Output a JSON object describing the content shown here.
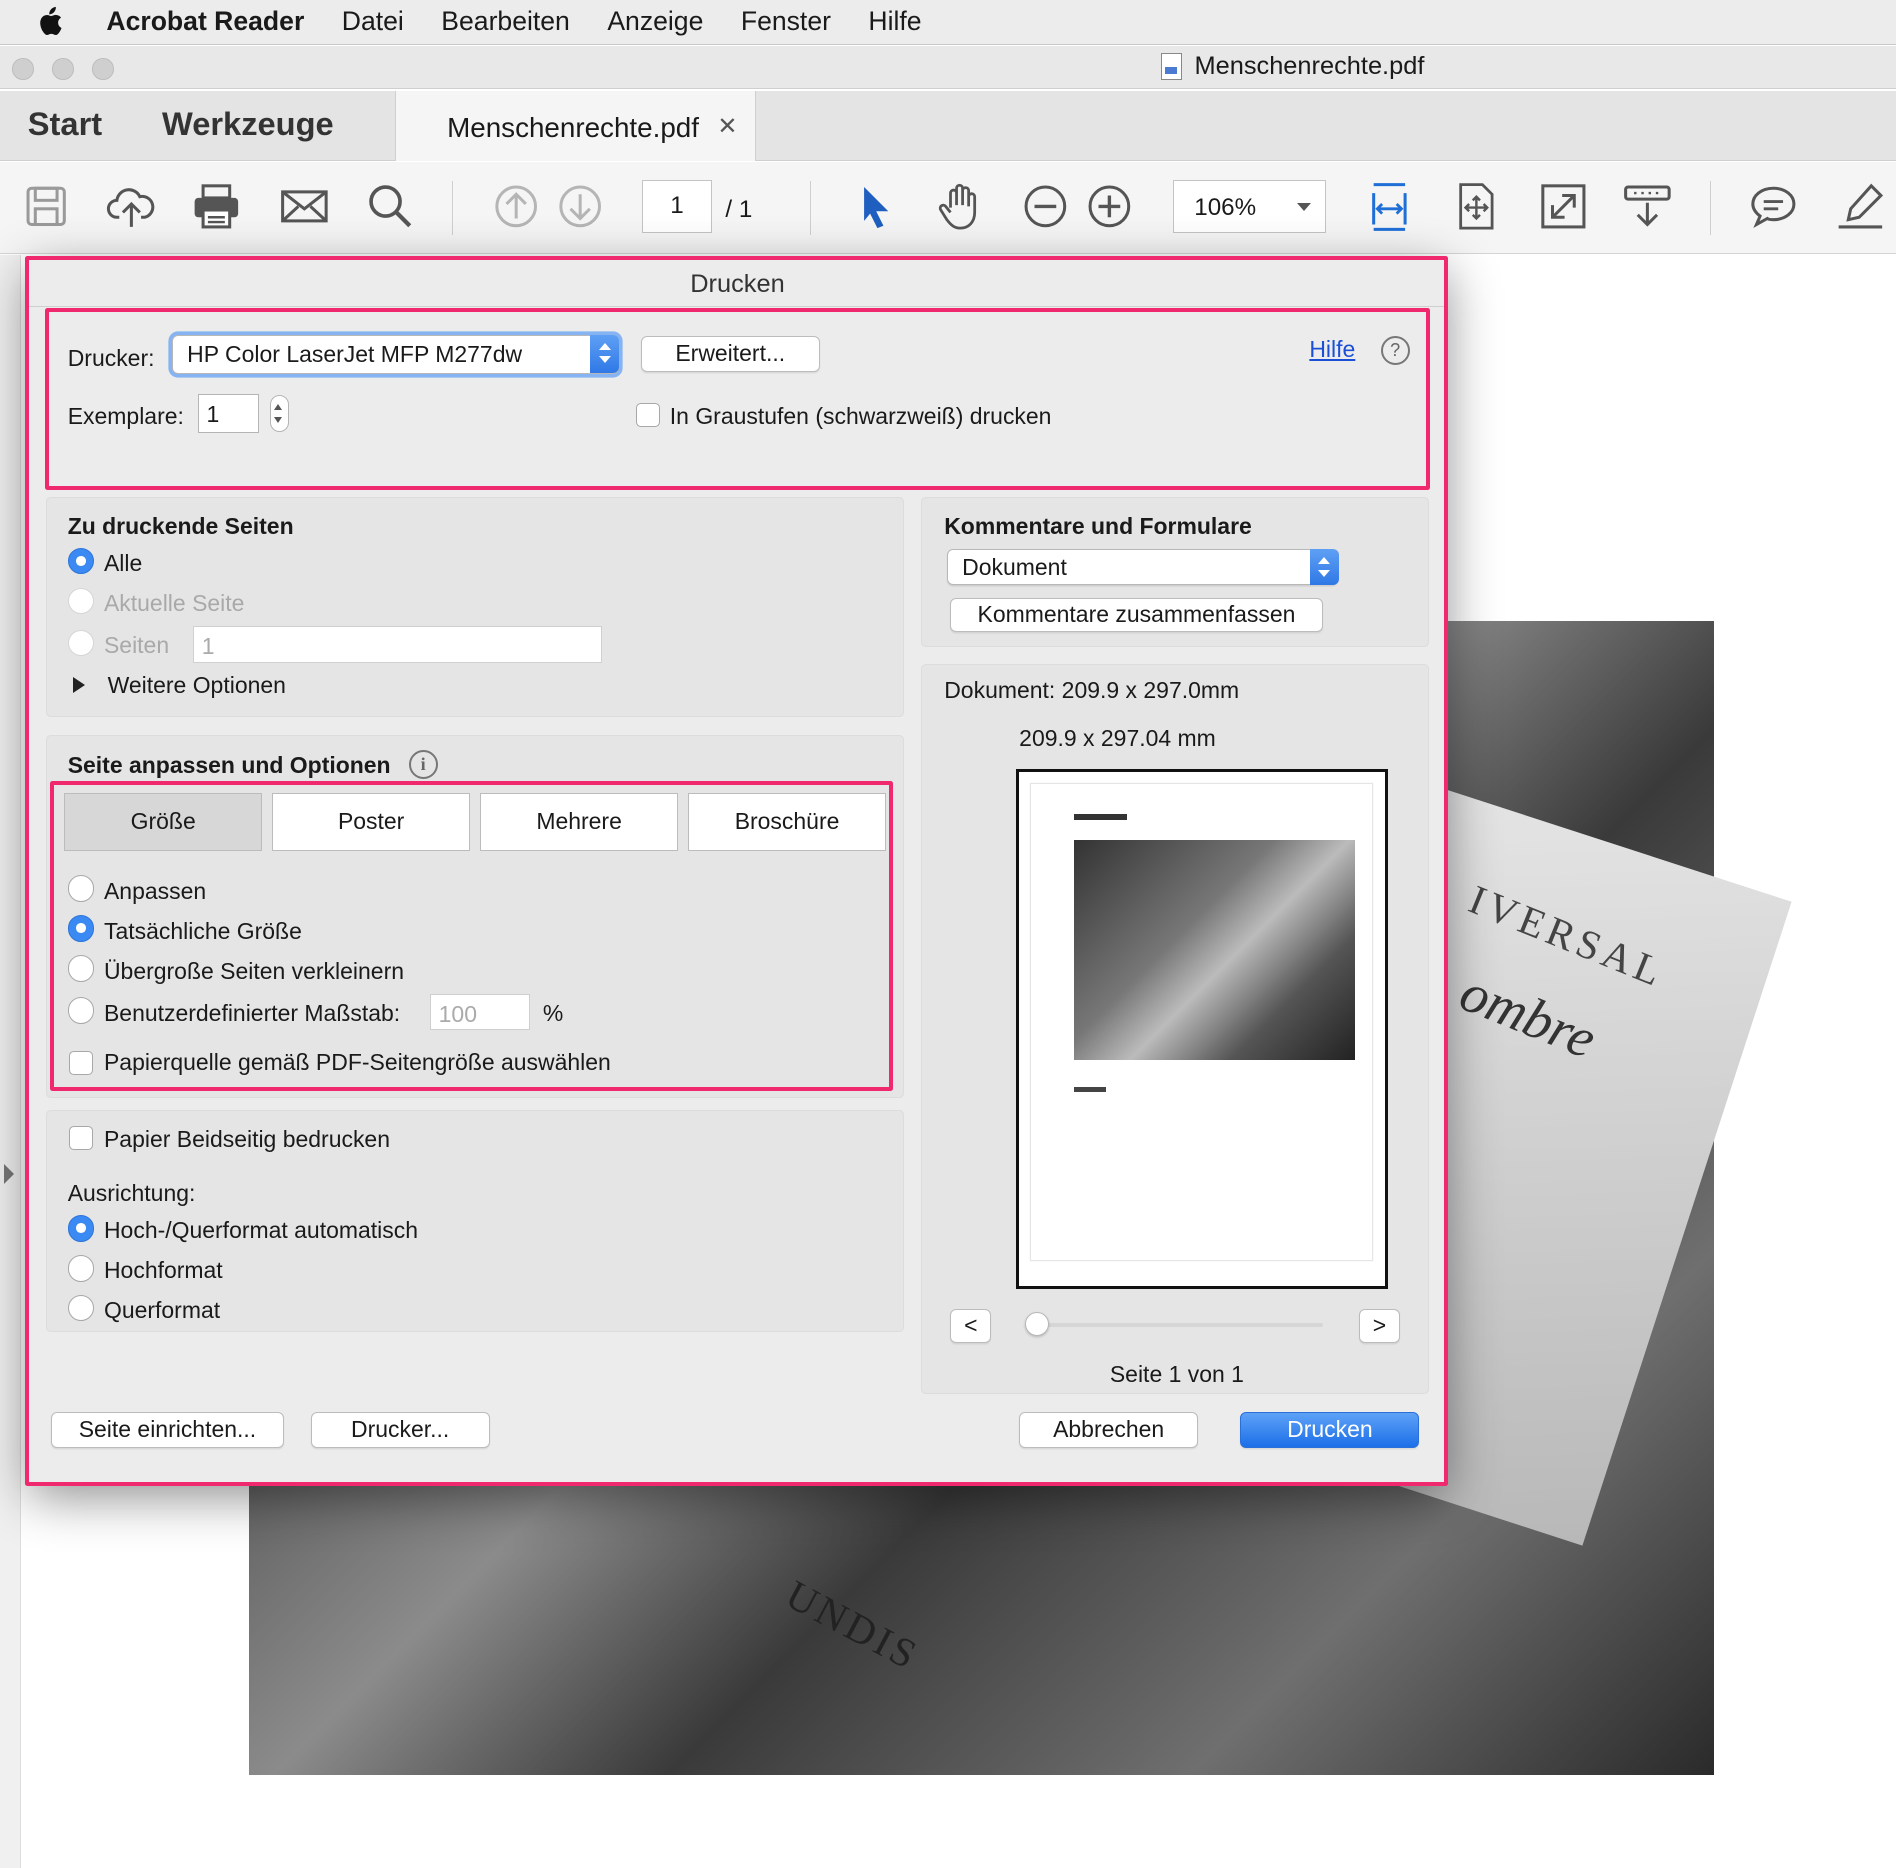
{
  "menubar": {
    "app_name": "Acrobat Reader",
    "items": [
      "Datei",
      "Bearbeiten",
      "Anzeige",
      "Fenster",
      "Hilfe"
    ]
  },
  "window": {
    "title": "Menschenrechte.pdf"
  },
  "tabs": {
    "start": "Start",
    "tools": "Werkzeuge",
    "document": "Menschenrechte.pdf"
  },
  "toolbar": {
    "page_current": "1",
    "page_total": "/ 1",
    "zoom": "106%",
    "icons": [
      "save-icon",
      "upload-cloud-icon",
      "print-icon",
      "mail-icon",
      "search-icon",
      "page-up-icon",
      "page-down-icon",
      "select-arrow-icon",
      "hand-icon",
      "zoom-out-icon",
      "zoom-in-icon",
      "fit-width-icon",
      "fit-page-icon",
      "fullscreen-icon",
      "read-mode-icon",
      "comment-icon",
      "highlight-pen-icon"
    ]
  },
  "dialog": {
    "title": "Drucken",
    "printer_label": "Drucker:",
    "printer_value": "HP Color LaserJet MFP M277dw",
    "advanced_button": "Erweitert...",
    "help_link": "Hilfe",
    "copies_label": "Exemplare:",
    "copies_value": "1",
    "grayscale_label": "In Graustufen (schwarzweiß) drucken",
    "pages": {
      "heading": "Zu druckende Seiten",
      "all": "Alle",
      "current": "Aktuelle Seite",
      "pages": "Seiten",
      "pages_value": "1",
      "more_options": "Weitere Optionen"
    },
    "fit": {
      "heading": "Seite anpassen und Optionen",
      "tabs": [
        "Größe",
        "Poster",
        "Mehrere",
        "Broschüre"
      ],
      "fit": "Anpassen",
      "actual": "Tatsächliche Größe",
      "shrink": "Übergroße Seiten verkleinern",
      "custom": "Benutzerdefinierter Maßstab:",
      "custom_value": "100",
      "percent": "%",
      "paper_source": "Papierquelle gemäß PDF-Seitengröße auswählen"
    },
    "duplex": "Papier Beidseitig bedrucken",
    "orientation": {
      "label": "Ausrichtung:",
      "auto": "Hoch-/Querformat automatisch",
      "portrait": "Hochformat",
      "landscape": "Querformat"
    },
    "comments": {
      "heading": "Kommentare und Formulare",
      "value": "Dokument",
      "summarize_button": "Kommentare zusammenfassen"
    },
    "preview": {
      "document_size": "Dokument: 209.9 x 297.0mm",
      "paper_size": "209.9 x 297.04 mm",
      "prev": "<",
      "next": ">",
      "page_info": "Seite 1 von 1"
    },
    "buttons": {
      "page_setup": "Seite einrichten...",
      "printer": "Drucker...",
      "cancel": "Abbrechen",
      "print": "Drucken"
    }
  },
  "background_photo_text": [
    "IVERSAL",
    "ombre",
    "UNDIS"
  ],
  "colors": {
    "highlight": "#f0286d",
    "accent": "#3b8af3",
    "link": "#1a4fd6"
  }
}
